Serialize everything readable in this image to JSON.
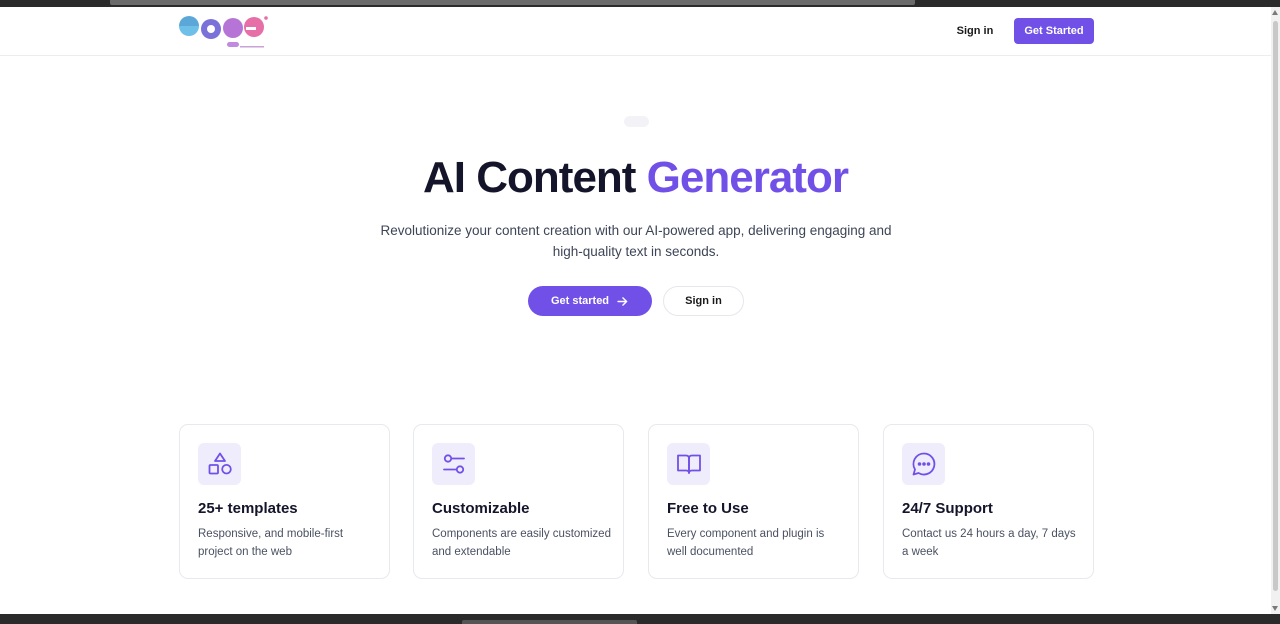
{
  "header": {
    "logo_icon": "logo-icon",
    "sign_in_label": "Sign in",
    "get_started_label": "Get Started"
  },
  "hero": {
    "title_main": "AI Content ",
    "title_accent": "Generator",
    "subtitle": "Revolutionize your content creation with our AI-powered app, delivering engaging and high-quality text in seconds.",
    "primary_button_label": "Get started",
    "primary_button_icon": "arrow-right-icon",
    "secondary_button_label": "Sign in"
  },
  "features": [
    {
      "icon": "shapes-icon",
      "title": "25+ templates",
      "description": "Responsive, and mobile-first project on the web"
    },
    {
      "icon": "sliders-icon",
      "title": "Customizable",
      "description": "Components are easily customized and extendable"
    },
    {
      "icon": "book-open-icon",
      "title": "Free to Use",
      "description": "Every component and plugin is well documented"
    },
    {
      "icon": "chat-bubble-icon",
      "title": "24/7 Support",
      "description": "Contact us 24 hours a day, 7 days a week"
    }
  ],
  "colors": {
    "accent": "#7150e8",
    "heading": "#14142a",
    "icon_bg": "#efedfc"
  }
}
